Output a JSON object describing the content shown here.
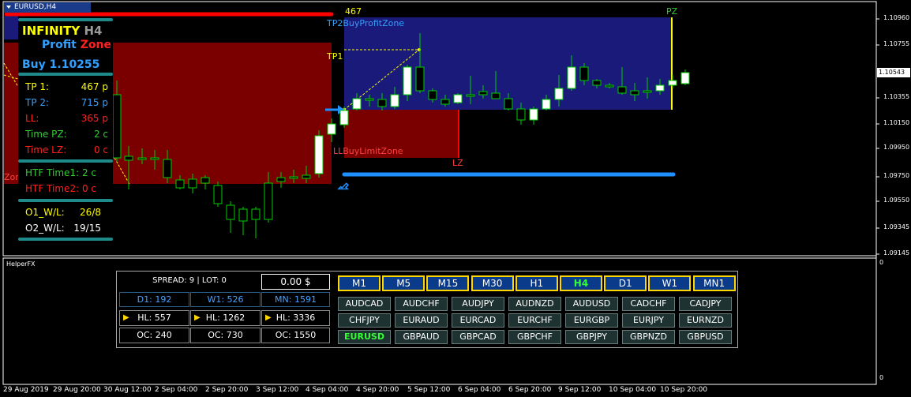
{
  "window": {
    "title": "EURUSD,H4",
    "indicator_window_title": "HelperFX",
    "indicator_scale_top": "0",
    "indicator_scale_bottom": "0"
  },
  "price_axis": {
    "labels": [
      "1.10960",
      "1.10755",
      "1.10543",
      "1.10355",
      "1.10150",
      "1.09950",
      "1.09750",
      "1.09550",
      "1.09345",
      "1.09145"
    ],
    "current_price": "1.10543"
  },
  "time_axis": {
    "labels": [
      "29 Aug 2019",
      "29 Aug 20:00",
      "30 Aug 12:00",
      "2 Sep 04:00",
      "2 Sep 20:00",
      "3 Sep 12:00",
      "4 Sep 04:00",
      "4 Sep 20:00",
      "5 Sep 12:00",
      "6 Sep 04:00",
      "6 Sep 20:00",
      "9 Sep 12:00",
      "10 Sep 04:00",
      "10 Sep 20:00"
    ]
  },
  "info_panel": {
    "logo_word1": "INFINITY",
    "logo_word2": "H4",
    "logo_word3": "Profit",
    "logo_word4": "Zone",
    "signal": "Buy 1.10255",
    "rows": [
      {
        "label": "TP 1:",
        "value": "467 p",
        "color": "#ffff00"
      },
      {
        "label": "TP 2:",
        "value": "715 p",
        "color": "#33a0ff"
      },
      {
        "label": "LL:",
        "value": "365 p",
        "color": "#ff2020"
      },
      {
        "label": "Time PZ:",
        "value": "2 c",
        "color": "#33cc33"
      },
      {
        "label": "Time LZ:",
        "value": "0 c",
        "color": "#ff2020"
      }
    ],
    "htf_rows": [
      {
        "label": "HTF Time1:",
        "value": "2 c",
        "color": "#33cc33"
      },
      {
        "label": "HTF Time2:",
        "value": "0 c",
        "color": "#ff2020"
      }
    ],
    "wl_rows": [
      {
        "label": "O1_W/L:",
        "value": "26/8",
        "color": "#ffff00"
      },
      {
        "label": "O2_W/L:",
        "value": "19/15",
        "color": "#ffffff"
      }
    ]
  },
  "zones": {
    "tp_value": "467",
    "tp2_label": "TP2BuyProfitZone",
    "tp1_label": "TP1",
    "pz_label": "PZ",
    "ll_label": "LLBuyLimitZone",
    "lz_label": "LZ",
    "left_cut_label": "Zon"
  },
  "helper": {
    "spread_lot": "SPREAD: 9  |  LOT: 0",
    "profit": "0.00 $",
    "ranges": [
      {
        "label": "D1: 192"
      },
      {
        "label": "W1: 526"
      },
      {
        "label": "MN: 1591"
      }
    ],
    "hl": [
      {
        "label": "HL: 557"
      },
      {
        "label": "HL: 1262"
      },
      {
        "label": "HL: 3336"
      }
    ],
    "oc": [
      {
        "label": "OC: 240"
      },
      {
        "label": "OC: 730"
      },
      {
        "label": "OC: 1550"
      }
    ],
    "timeframes": [
      "M1",
      "M5",
      "M15",
      "M30",
      "H1",
      "H4",
      "D1",
      "W1",
      "MN1"
    ],
    "active_timeframe": "H4",
    "pairs": [
      [
        "AUDCAD",
        "AUDCHF",
        "AUDJPY",
        "AUDNZD",
        "AUDUSD",
        "CADCHF",
        "CADJPY"
      ],
      [
        "CHFJPY",
        "EURAUD",
        "EURCAD",
        "EURCHF",
        "EURGBP",
        "EURJPY",
        "EURNZD"
      ],
      [
        "EURUSD",
        "GBPAUD",
        "GBPCAD",
        "GBPCHF",
        "GBPJPY",
        "GBPNZD",
        "GBPUSD"
      ]
    ],
    "active_pair": "EURUSD"
  },
  "colors": {
    "bull_candle": "#ffffff",
    "bear_candle": "#000000",
    "wick": "#00cc00",
    "profit_zone": "#1a1a7a",
    "loss_zone": "#7a0000",
    "axis": "#ffffff"
  }
}
